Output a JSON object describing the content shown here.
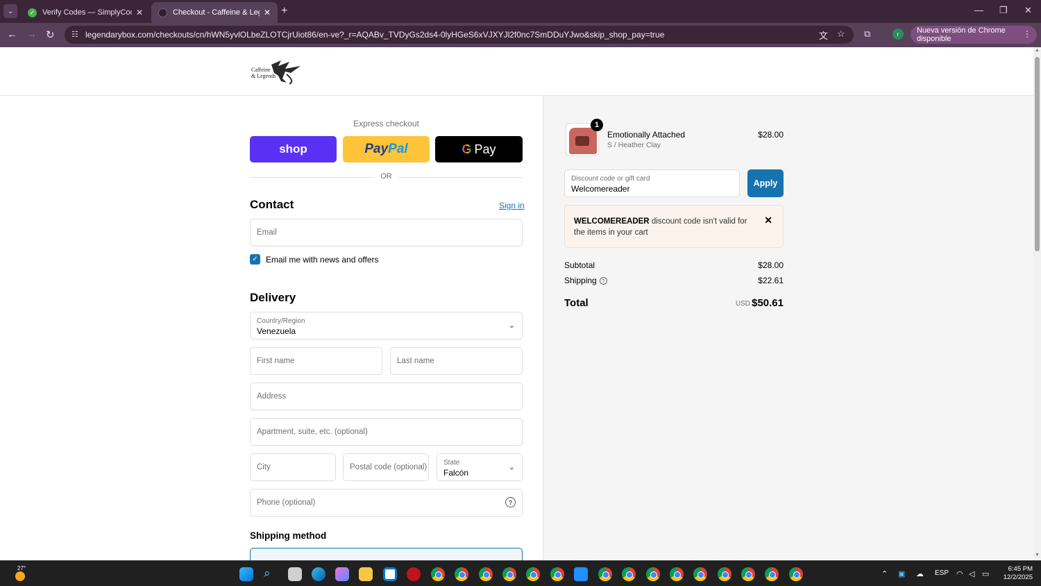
{
  "browser": {
    "tabs": [
      {
        "title": "Verify Codes — SimplyCodes",
        "active": false
      },
      {
        "title": "Checkout - Caffeine & Legends",
        "active": true
      }
    ],
    "url": "legendarybox.com/checkouts/cn/hWN5yvlOLbeZLOTCjrUiot86/en-ve?_r=AQABv_TVDyGs2ds4-0lyHGeS6xVJXYJl2f0nc7SmDDuYJwo&skip_shop_pay=true",
    "update_pill": "Nueva versión de Chrome disponible",
    "profile_initial": "r"
  },
  "header": {
    "logo_line1": "Caffeine",
    "logo_line2": "& Legends"
  },
  "checkout": {
    "express_label": "Express checkout",
    "shop_label": "shop",
    "paypal_p1": "Pay",
    "paypal_p2": "Pal",
    "gpay_g": "G",
    "gpay_label": "Pay",
    "or_label": "OR",
    "contact_heading": "Contact",
    "sign_in": "Sign in",
    "email_placeholder": "Email",
    "email_opt_in": "Email me with news and offers",
    "delivery_heading": "Delivery",
    "country_label": "Country/Region",
    "country_value": "Venezuela",
    "first_name_ph": "First name",
    "last_name_ph": "Last name",
    "address_ph": "Address",
    "apartment_ph": "Apartment, suite, etc. (optional)",
    "city_ph": "City",
    "postal_ph": "Postal code (optional)",
    "state_label": "State",
    "state_value": "Falcón",
    "phone_ph": "Phone (optional)",
    "shipping_method_heading": "Shipping method"
  },
  "summary": {
    "product": {
      "quantity": "1",
      "name": "Emotionally Attached",
      "variant": "S / Heather Clay",
      "price": "$28.00"
    },
    "discount_label": "Discount code or gift card",
    "discount_value": "Welcomereader",
    "apply_label": "Apply",
    "error_code": "WELCOMEREADER",
    "error_text": " discount code isn't valid for the items in your cart",
    "subtotal_label": "Subtotal",
    "subtotal_value": "$28.00",
    "shipping_label": "Shipping",
    "shipping_value": "$22.61",
    "total_label": "Total",
    "currency": "USD",
    "total_value": "$50.61"
  },
  "taskbar": {
    "weather_temp": "27°",
    "language": "ESP",
    "time": "6:45 PM",
    "date": "12/2/2025"
  },
  "colors": {
    "accent_blue": "#1773b0",
    "shop_purple": "#5a31f4",
    "paypal_yellow": "#ffc439",
    "chrome_frame": "#3b2639"
  }
}
